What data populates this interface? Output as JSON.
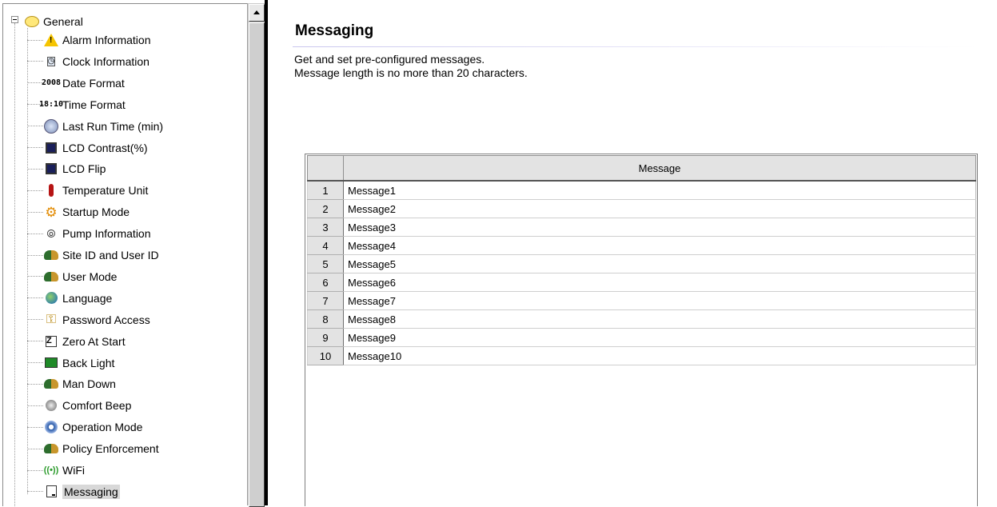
{
  "tree": {
    "root_label": "General",
    "items": [
      {
        "label": "Alarm Information",
        "icon": "warning-icon"
      },
      {
        "label": "Clock Information",
        "icon": "clock-icon"
      },
      {
        "label": "Date Format",
        "icon": "date-icon",
        "glyph": "2008"
      },
      {
        "label": "Time Format",
        "icon": "time-icon",
        "glyph": "18:10"
      },
      {
        "label": "Last Run Time (min)",
        "icon": "stopwatch-icon"
      },
      {
        "label": "LCD Contrast(%)",
        "icon": "lcd-icon"
      },
      {
        "label": "LCD Flip",
        "icon": "lcd-icon"
      },
      {
        "label": "Temperature Unit",
        "icon": "thermometer-icon"
      },
      {
        "label": "Startup Mode",
        "icon": "gear-icon"
      },
      {
        "label": "Pump Information",
        "icon": "pump-icon"
      },
      {
        "label": "Site ID and User ID",
        "icon": "users-icon"
      },
      {
        "label": "User Mode",
        "icon": "users-icon"
      },
      {
        "label": "Language",
        "icon": "globe-icon"
      },
      {
        "label": "Password Access",
        "icon": "key-icon"
      },
      {
        "label": "Zero At Start",
        "icon": "zero-icon",
        "glyph": "Z"
      },
      {
        "label": "Back Light",
        "icon": "backlight-icon"
      },
      {
        "label": "Man Down",
        "icon": "users-icon"
      },
      {
        "label": "Comfort Beep",
        "icon": "speaker-icon"
      },
      {
        "label": "Operation Mode",
        "icon": "operation-mode-icon"
      },
      {
        "label": "Policy Enforcement",
        "icon": "users-icon"
      },
      {
        "label": "WiFi",
        "icon": "wifi-icon",
        "glyph": "((•))"
      },
      {
        "label": "Messaging",
        "icon": "message-icon",
        "selected": true
      }
    ]
  },
  "main": {
    "title": "Messaging",
    "description_line1": "Get and set pre-configured messages.",
    "description_line2": "Message length is no more than 20 characters.",
    "table": {
      "column_header": "Message",
      "rows": [
        {
          "num": "1",
          "message": "Message1"
        },
        {
          "num": "2",
          "message": "Message2"
        },
        {
          "num": "3",
          "message": "Message3"
        },
        {
          "num": "4",
          "message": "Message4"
        },
        {
          "num": "5",
          "message": "Message5"
        },
        {
          "num": "6",
          "message": "Message6"
        },
        {
          "num": "7",
          "message": "Message7"
        },
        {
          "num": "8",
          "message": "Message8"
        },
        {
          "num": "9",
          "message": "Message9"
        },
        {
          "num": "10",
          "message": "Message10"
        }
      ]
    }
  },
  "colors": {
    "header_bg": "#e3e3e3",
    "selection_bg": "#d8d8d8",
    "splitter": "#000000"
  }
}
